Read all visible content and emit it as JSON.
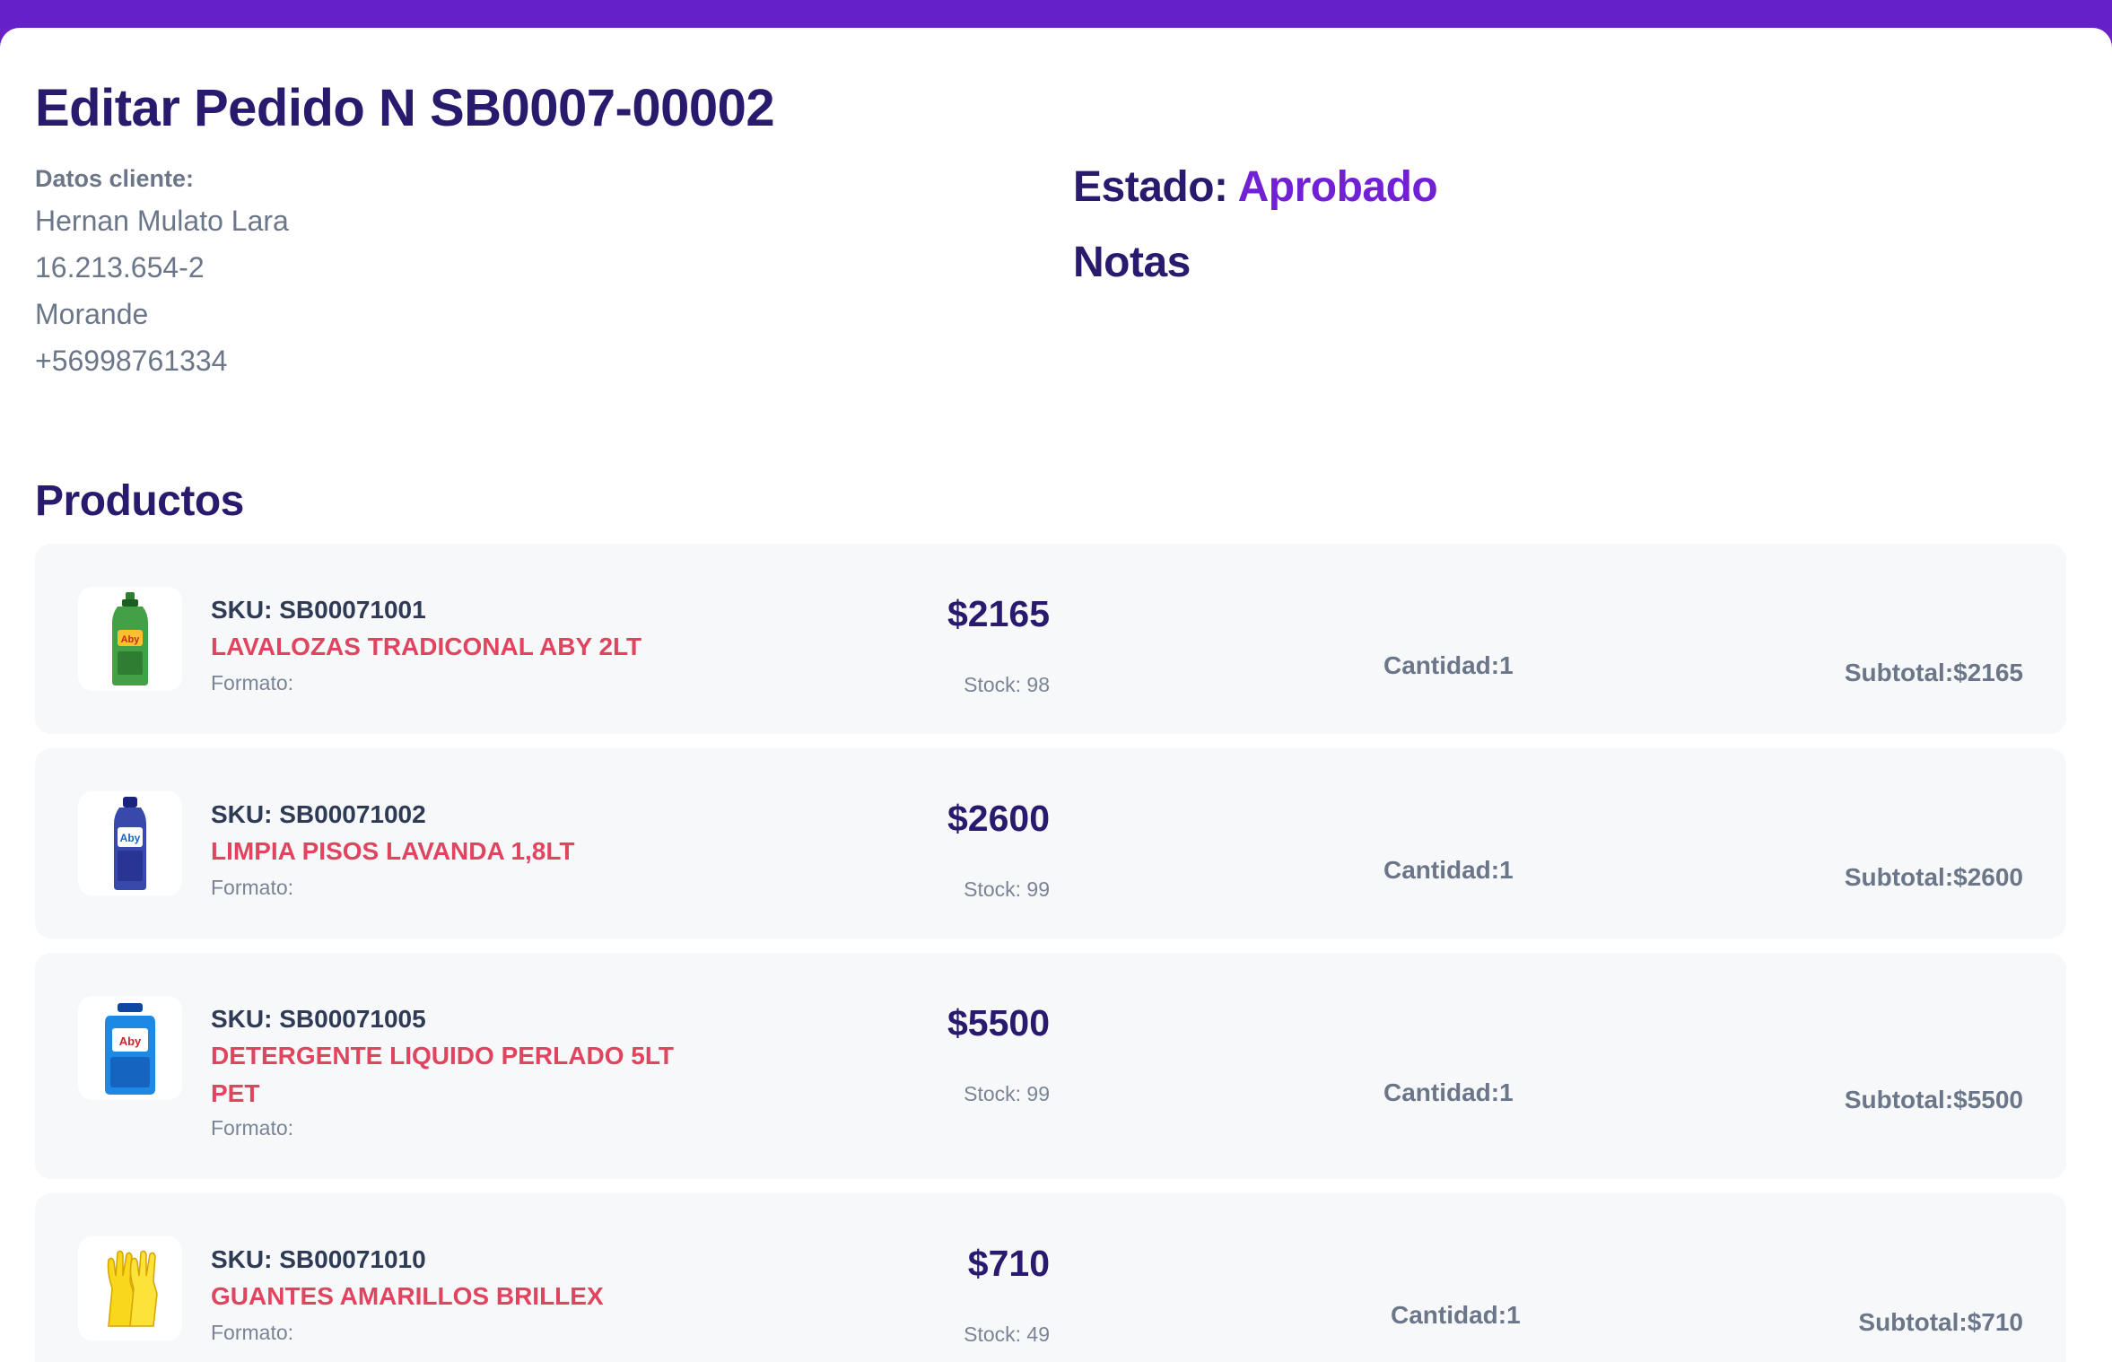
{
  "header": {
    "title": "Editar Pedido N SB0007-00002"
  },
  "client": {
    "label": "Datos cliente:",
    "name": "Hernan Mulato Lara",
    "rut": "16.213.654-2",
    "location": "Morande",
    "phone": "+56998761334"
  },
  "status": {
    "label": "Estado:",
    "value": "Aprobado",
    "notes_label": "Notas"
  },
  "colors": {
    "accent": "#7120d3",
    "heading": "#2a1a6e",
    "product_name": "#e0445e",
    "topbar": "#6620c9"
  },
  "products_section": {
    "title": "Productos",
    "items": [
      {
        "sku": "SKU: SB00071001",
        "name": "LAVALOZAS TRADICONAL ABY 2LT",
        "format_label": "Formato:",
        "price": "$2165",
        "stock": "Stock: 98",
        "quantity": "Cantidad:1",
        "subtotal": "Subtotal:$2165",
        "image_icon": "green-dish-soap-bottle"
      },
      {
        "sku": "SKU: SB00071002",
        "name": "LIMPIA PISOS LAVANDA 1,8LT",
        "format_label": "Formato:",
        "price": "$2600",
        "stock": "Stock: 99",
        "quantity": "Cantidad:1",
        "subtotal": "Subtotal:$2600",
        "image_icon": "purple-floor-cleaner-bottle"
      },
      {
        "sku": "SKU: SB00071005",
        "name": "DETERGENTE LIQUIDO PERLADO 5LT PET",
        "format_label": "Formato:",
        "price": "$5500",
        "stock": "Stock: 99",
        "quantity": "Cantidad:1",
        "subtotal": "Subtotal:$5500",
        "image_icon": "blue-detergent-jug"
      },
      {
        "sku": "SKU: SB00071010",
        "name": "GUANTES AMARILLOS BRILLEX",
        "format_label": "Formato:",
        "price": "$710",
        "stock": "Stock: 49",
        "quantity": "Cantidad:1",
        "subtotal": "Subtotal:$710",
        "image_icon": "yellow-gloves"
      }
    ]
  }
}
